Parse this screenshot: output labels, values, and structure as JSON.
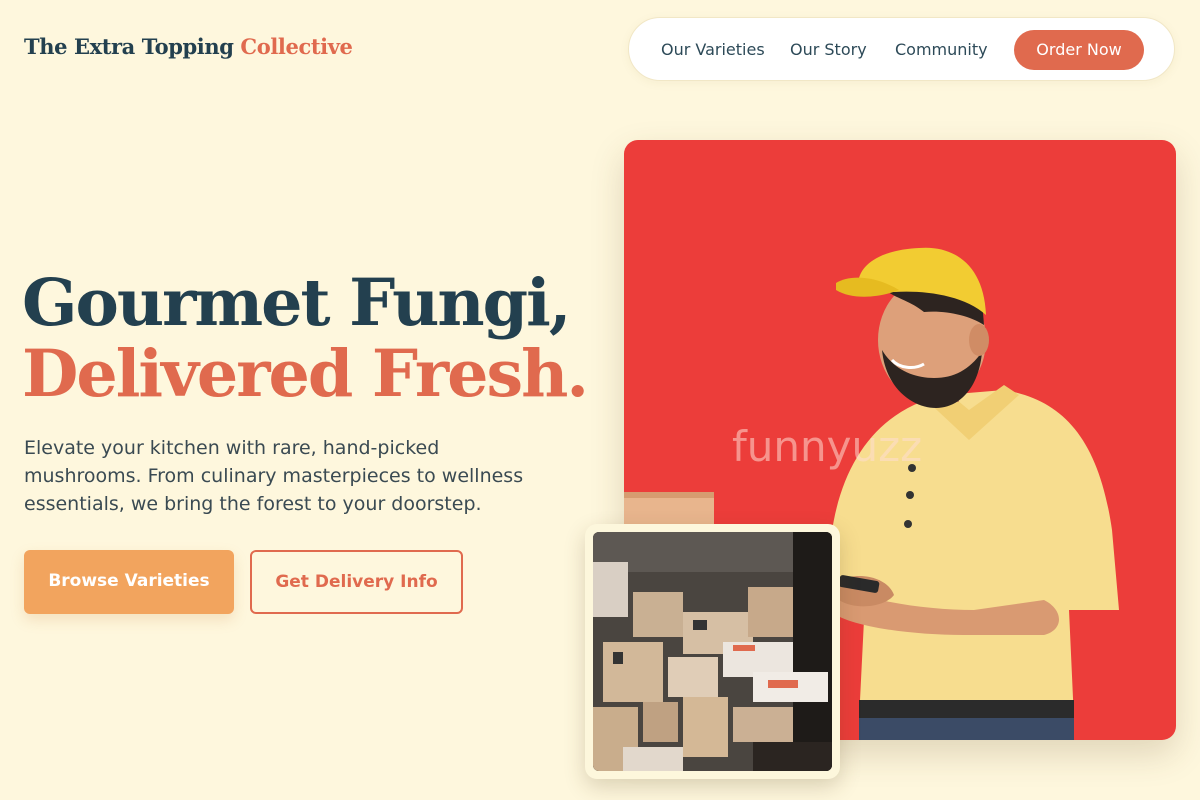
{
  "brand": {
    "name_main": "The Extra Topping",
    "name_accent": "Collective"
  },
  "nav": {
    "links": [
      "Our Varieties",
      "Our Story",
      "Community"
    ],
    "cta": "Order Now"
  },
  "hero": {
    "headline_line1": "Gourmet Fungi,",
    "headline_line2": "Delivered Fresh.",
    "subtitle": "Elevate your kitchen with rare, hand-picked mushrooms. From culinary masterpieces to wellness essentials, we bring the forest to your doorstep.",
    "primary_button": "Browse Varieties",
    "secondary_button": "Get Delivery Info"
  },
  "images": {
    "main_watermark": "funnyuzz",
    "main_icon": "delivery-man-photo",
    "inset_icon": "parcel-boxes-photo"
  },
  "colors": {
    "background": "#fef7dd",
    "navy": "#23404f",
    "accent": "#e06a4e",
    "primary_button": "#f2a45e",
    "hero_bg": "#ec3d3a"
  }
}
